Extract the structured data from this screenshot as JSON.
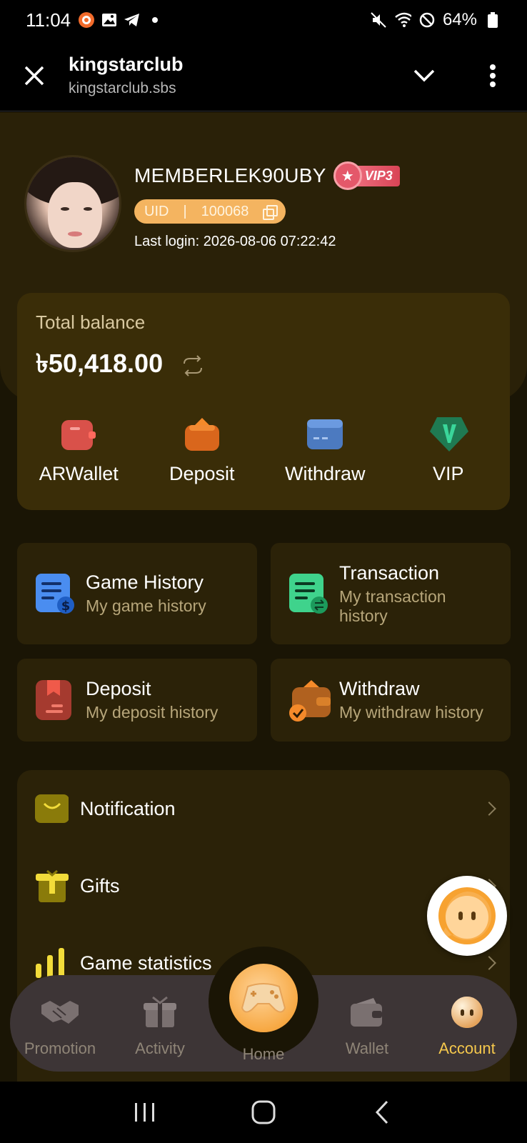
{
  "status_bar": {
    "time": "11:04",
    "battery": "64%",
    "left_icons": [
      "app-notification-icon",
      "gallery-icon",
      "telegram-icon",
      "dot-icon"
    ],
    "right_icons": [
      "mute-icon",
      "wifi-icon",
      "do-not-disturb-icon",
      "battery-icon"
    ]
  },
  "browser": {
    "title": "kingstarclub",
    "url": "kingstarclub.sbs"
  },
  "profile": {
    "username": "MEMBERLEK90UBY",
    "vip_level": "VIP3",
    "uid_label": "UID",
    "uid_separator": "|",
    "uid_value": "100068",
    "last_login": "Last login: 2026-08-06 07:22:42"
  },
  "balance": {
    "label": "Total balance",
    "amount": "৳50,418.00",
    "actions": [
      {
        "label": "ARWallet",
        "icon": "wallet-icon"
      },
      {
        "label": "Deposit",
        "icon": "deposit-icon"
      },
      {
        "label": "Withdraw",
        "icon": "card-icon"
      },
      {
        "label": "VIP",
        "icon": "vip-icon"
      }
    ]
  },
  "history": [
    {
      "title": "Game History",
      "subtitle": "My game history",
      "icon": "game-history-icon"
    },
    {
      "title": "Transaction",
      "subtitle": "My transaction history",
      "icon": "transaction-icon"
    },
    {
      "title": "Deposit",
      "subtitle": "My deposit history",
      "icon": "deposit-history-icon"
    },
    {
      "title": "Withdraw",
      "subtitle": "My withdraw history",
      "icon": "withdraw-history-icon"
    }
  ],
  "menu": [
    {
      "label": "Notification",
      "icon": "mail-icon"
    },
    {
      "label": "Gifts",
      "icon": "gift-icon"
    },
    {
      "label": "Game statistics",
      "icon": "bar-chart-icon"
    }
  ],
  "bottom_nav": [
    {
      "label": "Promotion",
      "icon": "handshake-icon"
    },
    {
      "label": "Activity",
      "icon": "gift-box-icon"
    },
    {
      "label": "Home",
      "icon": "gamepad-icon"
    },
    {
      "label": "Wallet",
      "icon": "wallet-icon"
    },
    {
      "label": "Account",
      "icon": "account-icon",
      "active": true
    }
  ],
  "colors": {
    "page_bg": "#1a1505",
    "card_bg": "#3a2d08",
    "accent": "#f5c84c",
    "uid_pill": "#f4b460"
  }
}
